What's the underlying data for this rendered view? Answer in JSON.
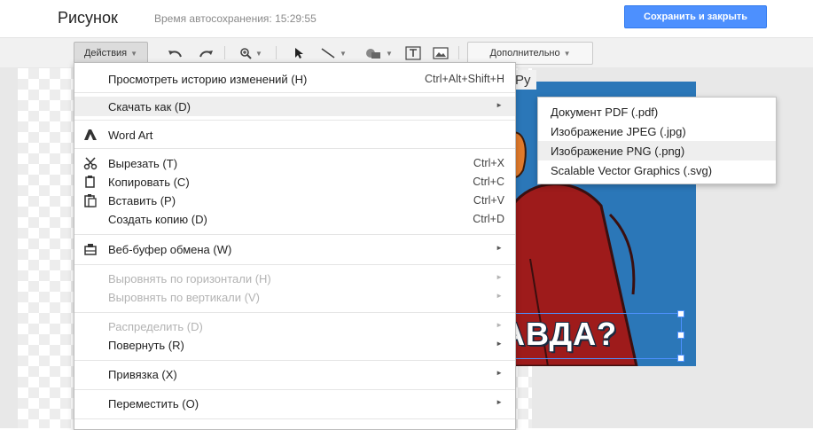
{
  "header": {
    "title": "Рисунок",
    "autosave": "Время автосохранения: 15:29:55",
    "save_close_label": "Сохранить и закрыть"
  },
  "toolbar": {
    "actions_label": "Действия",
    "more_label": "Дополнительно",
    "icons": [
      "undo-icon",
      "redo-icon",
      "zoom-icon",
      "select-arrow-icon",
      "line-icon",
      "shape-icon",
      "text-box-icon",
      "image-icon"
    ]
  },
  "canvas": {
    "partial_label": "Ру",
    "drawing_text": "АВДА?",
    "background_color": "#2b77b8"
  },
  "menu": {
    "items": [
      {
        "label": "Просмотреть историю изменений (H)",
        "shortcut": "Ctrl+Alt+Shift+H"
      },
      {
        "label": "Скачать как (D)",
        "submenu": true
      },
      {
        "label": "Word Art",
        "icon": "word-art-icon"
      },
      {
        "label": "Вырезать (T)",
        "shortcut": "Ctrl+X",
        "icon": "scissors-icon"
      },
      {
        "label": "Копировать (C)",
        "shortcut": "Ctrl+C",
        "icon": "copy-icon"
      },
      {
        "label": "Вставить (P)",
        "shortcut": "Ctrl+V",
        "icon": "paste-icon"
      },
      {
        "label": "Создать копию (D)",
        "shortcut": "Ctrl+D"
      },
      {
        "label": "Веб-буфер обмена (W)",
        "submenu": true,
        "icon": "clipboard-icon"
      },
      {
        "label": "Выровнять по горизонтали (H)",
        "submenu": true,
        "disabled": true
      },
      {
        "label": "Выровнять по вертикали (V)",
        "submenu": true,
        "disabled": true
      },
      {
        "label": "Распределить (D)",
        "submenu": true,
        "disabled": true
      },
      {
        "label": "Повернуть (R)",
        "submenu": true
      },
      {
        "label": "Привязка (X)",
        "submenu": true
      },
      {
        "label": "Переместить (O)",
        "submenu": true
      }
    ]
  },
  "submenu": {
    "items": [
      {
        "label": "Документ PDF (.pdf)"
      },
      {
        "label": "Изображение JPEG (.jpg)"
      },
      {
        "label": "Изображение PNG (.png)"
      },
      {
        "label": "Scalable Vector Graphics (.svg)"
      }
    ]
  },
  "colors": {
    "accent": "#4d90fe",
    "highlight": "#eeeeee",
    "disabled_text": "#b3b3b3"
  }
}
